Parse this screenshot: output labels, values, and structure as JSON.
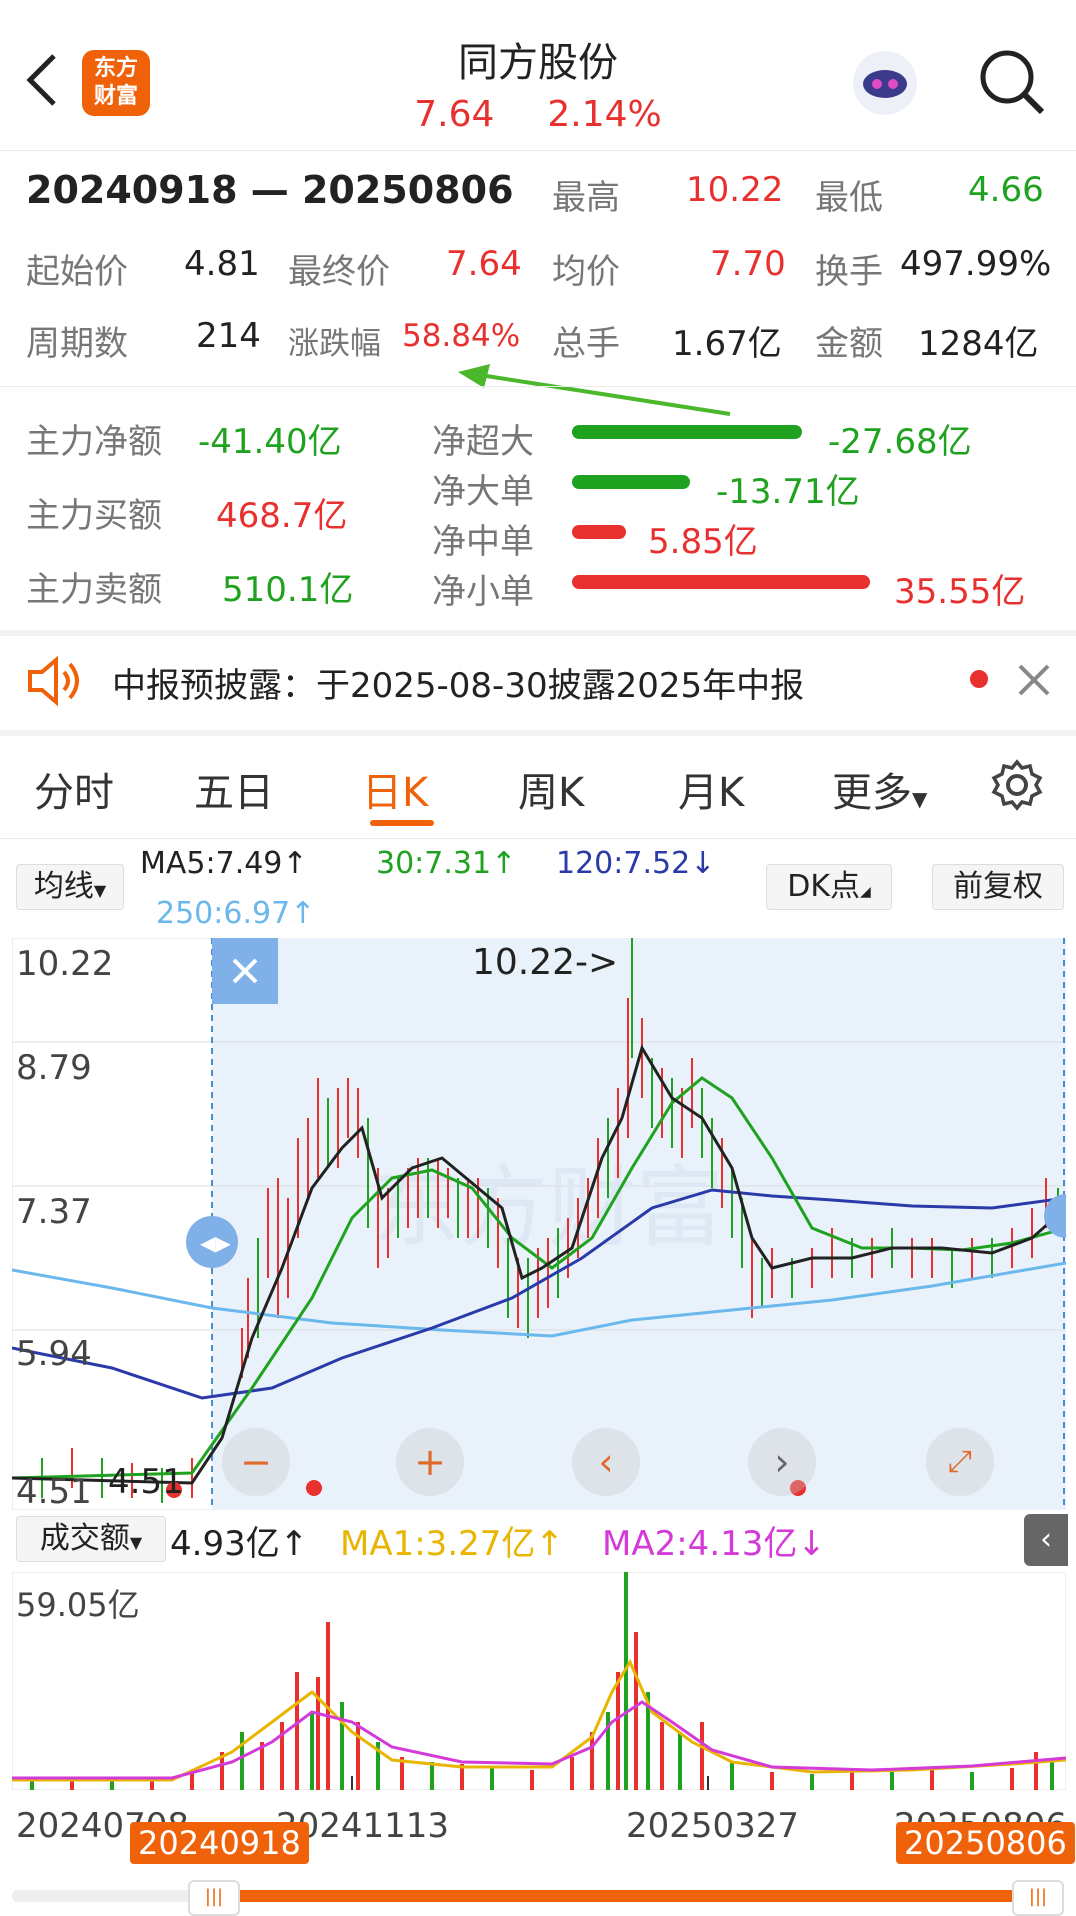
{
  "header": {
    "logo_text_top": "东方",
    "logo_text_bottom": "财富",
    "title": "同方股份",
    "price": "7.64",
    "change_pct": "2.14%"
  },
  "range_summary": {
    "range": "20240918 — 20250806",
    "high_label": "最高",
    "high": "10.22",
    "low_label": "最低",
    "low": "4.66",
    "start_label": "起始价",
    "start": "4.81",
    "end_label": "最终价",
    "end": "7.64",
    "avg_label": "均价",
    "avg": "7.70",
    "turnover_label": "换手",
    "turnover": "497.99%",
    "periods_label": "周期数",
    "periods": "214",
    "change_label": "涨跌幅",
    "change": "58.84%",
    "volume_label": "总手",
    "volume": "1.67亿",
    "amount_label": "金额",
    "amount": "1284亿"
  },
  "fund_flow": {
    "net_label": "主力净额",
    "net": "-41.40亿",
    "buy_label": "主力买额",
    "buy": "468.7亿",
    "sell_label": "主力卖额",
    "sell": "510.1亿",
    "super_label": "净超大",
    "super": "-27.68亿",
    "big_label": "净大单",
    "big": "-13.71亿",
    "mid_label": "净中单",
    "mid": "5.85亿",
    "small_label": "净小单",
    "small": "35.55亿"
  },
  "notice": {
    "text": "中报预披露：于2025-08-30披露2025年中报"
  },
  "tabs": [
    "分时",
    "五日",
    "日K",
    "周K",
    "月K",
    "更多"
  ],
  "ma_bar": {
    "selector": "均线",
    "ma5": "MA5:7.49↑",
    "ma30": "30:7.31↑",
    "ma120": "120:7.52↓",
    "ma250": "250:6.97↑",
    "dk": "DK点",
    "adjust": "前复权"
  },
  "price_axis": [
    "10.22",
    "8.79",
    "7.37",
    "5.94",
    "4.51"
  ],
  "high_marker": "10.22->",
  "low_marker": "4.51",
  "volume_bar": {
    "selector": "成交额",
    "value": "4.93亿↑",
    "ma1": "MA1:3.27亿↑",
    "ma2": "MA2:4.13亿↓",
    "axis_max": "59.05亿"
  },
  "date_axis": [
    "20240708",
    "20241113",
    "20250327",
    "20250806"
  ],
  "range_tags": {
    "start": "20240918",
    "end": "20250806"
  },
  "colors": {
    "up": "#e8312f",
    "down": "#1fa21f",
    "accent": "#f0620a",
    "ma120": "#2a3aa8",
    "ma250": "#6bb8ec"
  }
}
